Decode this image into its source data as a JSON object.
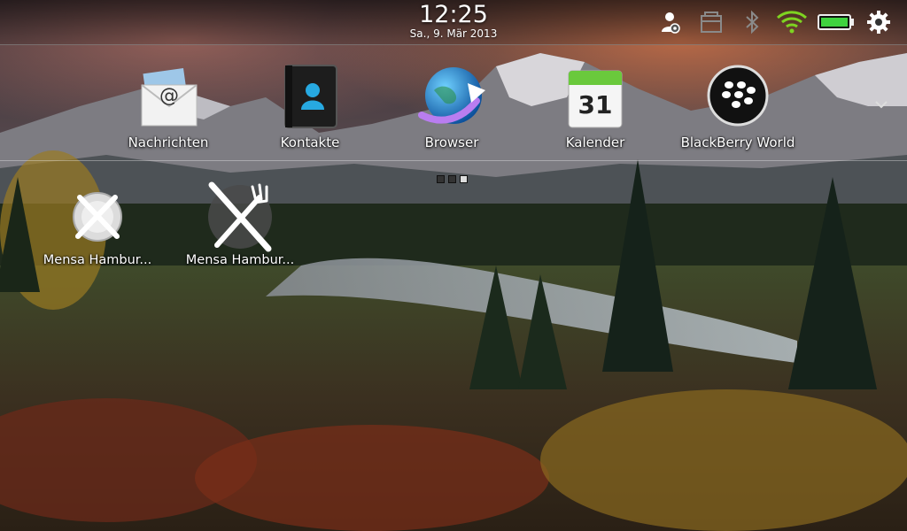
{
  "status": {
    "time": "12:25",
    "date": "Sa., 9. Mär 2013",
    "icons": [
      "account-settings-icon",
      "windows-icon",
      "bluetooth-icon",
      "wifi-icon",
      "battery-icon",
      "gear-icon"
    ]
  },
  "tray": {
    "apps": [
      {
        "label": "Nachrichten",
        "icon": "mail-envelope-icon"
      },
      {
        "label": "Kontakte",
        "icon": "contacts-book-icon"
      },
      {
        "label": "Browser",
        "icon": "globe-arrow-icon"
      },
      {
        "label": "Kalender",
        "icon": "calendar-icon",
        "day": "31"
      },
      {
        "label": "BlackBerry World",
        "icon": "blackberry-logo-icon"
      }
    ],
    "pager": {
      "count": 3,
      "active": 3
    }
  },
  "home": {
    "apps": [
      {
        "label": "Mensa Hambur...",
        "icon": "plate-fork-knife-icon"
      },
      {
        "label": "Mensa Hambur...",
        "icon": "fork-knife-icon"
      }
    ]
  },
  "colors": {
    "wifi": "#7ed321",
    "battery": "#3fd33f",
    "calendar_header": "#6ac93c"
  }
}
